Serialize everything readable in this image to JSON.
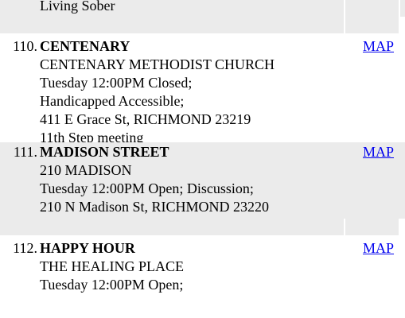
{
  "top_entry": {
    "last_line": "Living Sober"
  },
  "meetings": [
    {
      "number": "110.",
      "name": "CENTENARY",
      "lines": [
        "CENTENARY METHODIST CHURCH",
        "Tuesday 12:00PM Closed;",
        "Handicapped Accessible;",
        "411 E Grace St, RICHMOND 23219",
        "11th Step meeting"
      ],
      "map_label": "MAP"
    },
    {
      "number": "111.",
      "name": "MADISON STREET",
      "lines": [
        "210 MADISON",
        "Tuesday 12:00PM Open; Discussion;",
        "210 N Madison St, RICHMOND 23220"
      ],
      "map_label": "MAP"
    },
    {
      "number": "112.",
      "name": "HAPPY HOUR",
      "lines": [
        "THE HEALING PLACE",
        "Tuesday 12:00PM Open;"
      ],
      "map_label": "MAP"
    }
  ],
  "colors": {
    "shaded_row": "#ebebeb",
    "link": "#0000ee"
  }
}
